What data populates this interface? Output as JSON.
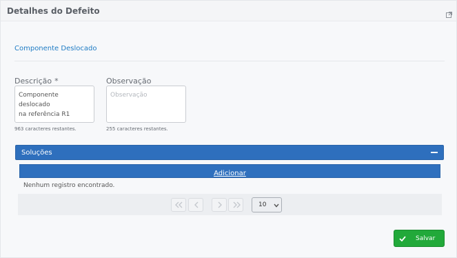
{
  "dialog": {
    "title": "Detalhes do Defeito",
    "popout_icon": "external-link-icon"
  },
  "section": {
    "heading": "Componente Deslocado"
  },
  "descricao": {
    "label": "Descrição",
    "required_mark": "*",
    "value": "Componente deslocado\nna referência R1",
    "chars_left": "963 caracteres restantes."
  },
  "observacao": {
    "label": "Observação",
    "placeholder": "Observação",
    "chars_left": "255 caracteres restantes."
  },
  "solucoes": {
    "title": "Soluções",
    "collapse_icon": "minus-icon",
    "add_label": "Adicionar",
    "empty_message": "Nenhum registro encontrado.",
    "paginator": {
      "first_icon": "double-chevron-left-icon",
      "prev_icon": "chevron-left-icon",
      "next_icon": "chevron-right-icon",
      "last_icon": "double-chevron-right-icon",
      "page_size": "10"
    }
  },
  "actions": {
    "save_label": "Salvar",
    "save_icon": "check-icon"
  },
  "colors": {
    "accent": "#1e7bc4",
    "panel_header": "#2e6fbd",
    "save_button": "#22a93a"
  }
}
